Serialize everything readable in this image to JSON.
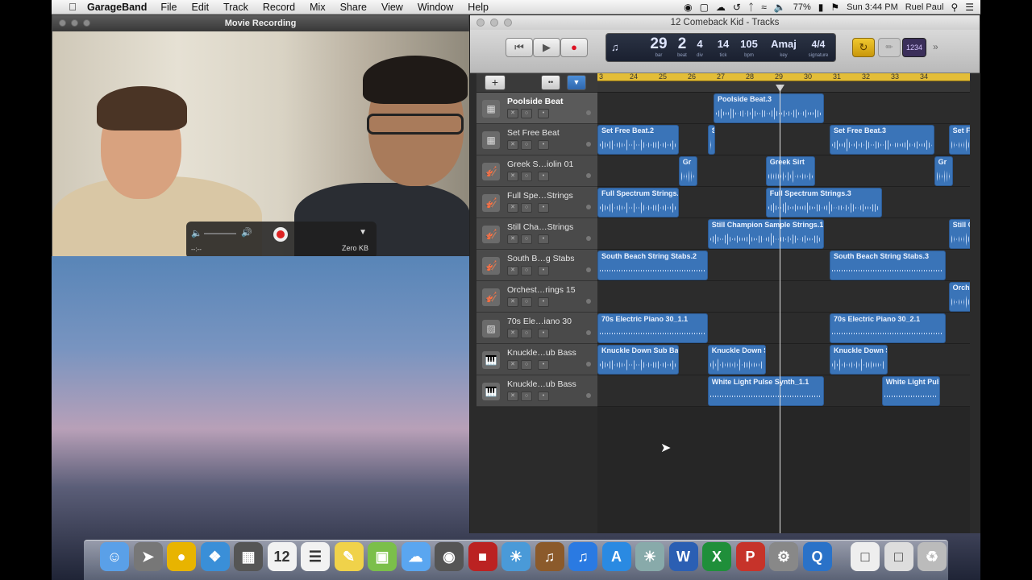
{
  "menubar": {
    "app_name": "GarageBand",
    "items": [
      "File",
      "Edit",
      "Track",
      "Record",
      "Mix",
      "Share",
      "View",
      "Window",
      "Help"
    ],
    "battery": "77%",
    "clock": "Sun 3:44 PM",
    "user": "Ruel Paul"
  },
  "movie": {
    "title": "Movie Recording",
    "time": "--:--",
    "size": "Zero KB"
  },
  "gb": {
    "window_title": "12 Comeback Kid - Tracks",
    "lcd": {
      "bar": "29",
      "bar_label": "bar",
      "beat": "2",
      "beat_label": "beat",
      "div": "4",
      "div_label": "div",
      "tick": "14",
      "tick_label": "tick",
      "tempo": "105",
      "tempo_label": "bpm",
      "key": "Amaj",
      "key_label": "key",
      "sig": "4/4",
      "sig_label": "signature"
    },
    "count_in": "1234",
    "ruler": [
      "3",
      "24",
      "25",
      "26",
      "27",
      "28",
      "29",
      "30",
      "31",
      "32",
      "33",
      "34"
    ],
    "tracks": [
      {
        "name": "Poolside Beat",
        "icon": "drum-machine-icon",
        "selected": true
      },
      {
        "name": "Set Free Beat",
        "icon": "drum-machine-icon",
        "selected": false
      },
      {
        "name": "Greek S…iolin 01",
        "icon": "violin-icon",
        "selected": false
      },
      {
        "name": "Full Spe…Strings",
        "icon": "strings-icon",
        "selected": false
      },
      {
        "name": "Still Cha…Strings",
        "icon": "strings-icon",
        "selected": false
      },
      {
        "name": "South B…g Stabs",
        "icon": "strings-icon",
        "selected": false
      },
      {
        "name": "Orchest…rings 15",
        "icon": "strings-icon",
        "selected": false
      },
      {
        "name": "70s Ele…iano 30",
        "icon": "electric-piano-icon",
        "selected": false
      },
      {
        "name": "Knuckle…ub Bass",
        "icon": "synth-icon",
        "selected": false
      },
      {
        "name": "Knuckle…ub Bass",
        "icon": "synth-icon",
        "selected": false
      }
    ],
    "regions": [
      {
        "track": 0,
        "label": "Poolside Beat.3",
        "start": 27,
        "end": 30.8
      },
      {
        "track": 1,
        "label": "Set Free Beat.2",
        "start": 23,
        "end": 25.8
      },
      {
        "track": 1,
        "label": "S",
        "start": 26.8,
        "end": 27.05
      },
      {
        "track": 1,
        "label": "Set Free Beat.3",
        "start": 31,
        "end": 34.6
      },
      {
        "track": 1,
        "label": "Set Free",
        "start": 35.1,
        "end": 36.2
      },
      {
        "track": 2,
        "label": "Gr",
        "start": 25.8,
        "end": 26.45
      },
      {
        "track": 2,
        "label": "Greek Sirt",
        "start": 28.8,
        "end": 30.5
      },
      {
        "track": 2,
        "label": "Gr",
        "start": 34.6,
        "end": 35.25
      },
      {
        "track": 3,
        "label": "Full Spectrum Strings.2",
        "start": 23,
        "end": 25.8
      },
      {
        "track": 3,
        "label": "Full Spectrum Strings.3",
        "start": 28.8,
        "end": 32.8
      },
      {
        "track": 4,
        "label": "Still Champion Sample Strings.1",
        "start": 26.8,
        "end": 30.8
      },
      {
        "track": 4,
        "label": "Still Ch",
        "start": 35.1,
        "end": 36.2
      },
      {
        "track": 5,
        "label": "South Beach String Stabs.2",
        "start": 23,
        "end": 26.8
      },
      {
        "track": 5,
        "label": "South Beach String Stabs.3",
        "start": 31,
        "end": 35
      },
      {
        "track": 6,
        "label": "Orche",
        "start": 35.1,
        "end": 36.2
      },
      {
        "track": 7,
        "label": "70s Electric Piano 30_1.1",
        "start": 23,
        "end": 26.8
      },
      {
        "track": 7,
        "label": "70s Electric Piano 30_2.1",
        "start": 31,
        "end": 35
      },
      {
        "track": 8,
        "label": "Knuckle Down Sub Bass",
        "start": 23,
        "end": 25.8
      },
      {
        "track": 8,
        "label": "Knuckle Down S",
        "start": 26.8,
        "end": 28.8
      },
      {
        "track": 8,
        "label": "Knuckle Down S",
        "start": 31,
        "end": 33
      },
      {
        "track": 9,
        "label": "White Light Pulse Synth_1.1",
        "start": 26.8,
        "end": 30.8
      },
      {
        "track": 9,
        "label": "White Light Puls",
        "start": 32.8,
        "end": 34.8
      }
    ]
  },
  "dock": [
    "finder-icon",
    "launchpad-icon",
    "chrome-icon",
    "safari-icon",
    "apps-icon",
    "calendar-icon",
    "reminders-icon",
    "stickies-icon",
    "preview-icon",
    "messages-icon",
    "facetime-icon",
    "photo-booth-icon",
    "iphoto-icon",
    "garageband-icon",
    "itunes-icon",
    "app-store-icon",
    "photos-icon",
    "word-icon",
    "excel-icon",
    "powerpoint-icon",
    "system-preferences-icon",
    "quicktime-icon",
    "document-icon",
    "folder-icon",
    "trash-icon"
  ],
  "calendar_day": "12"
}
